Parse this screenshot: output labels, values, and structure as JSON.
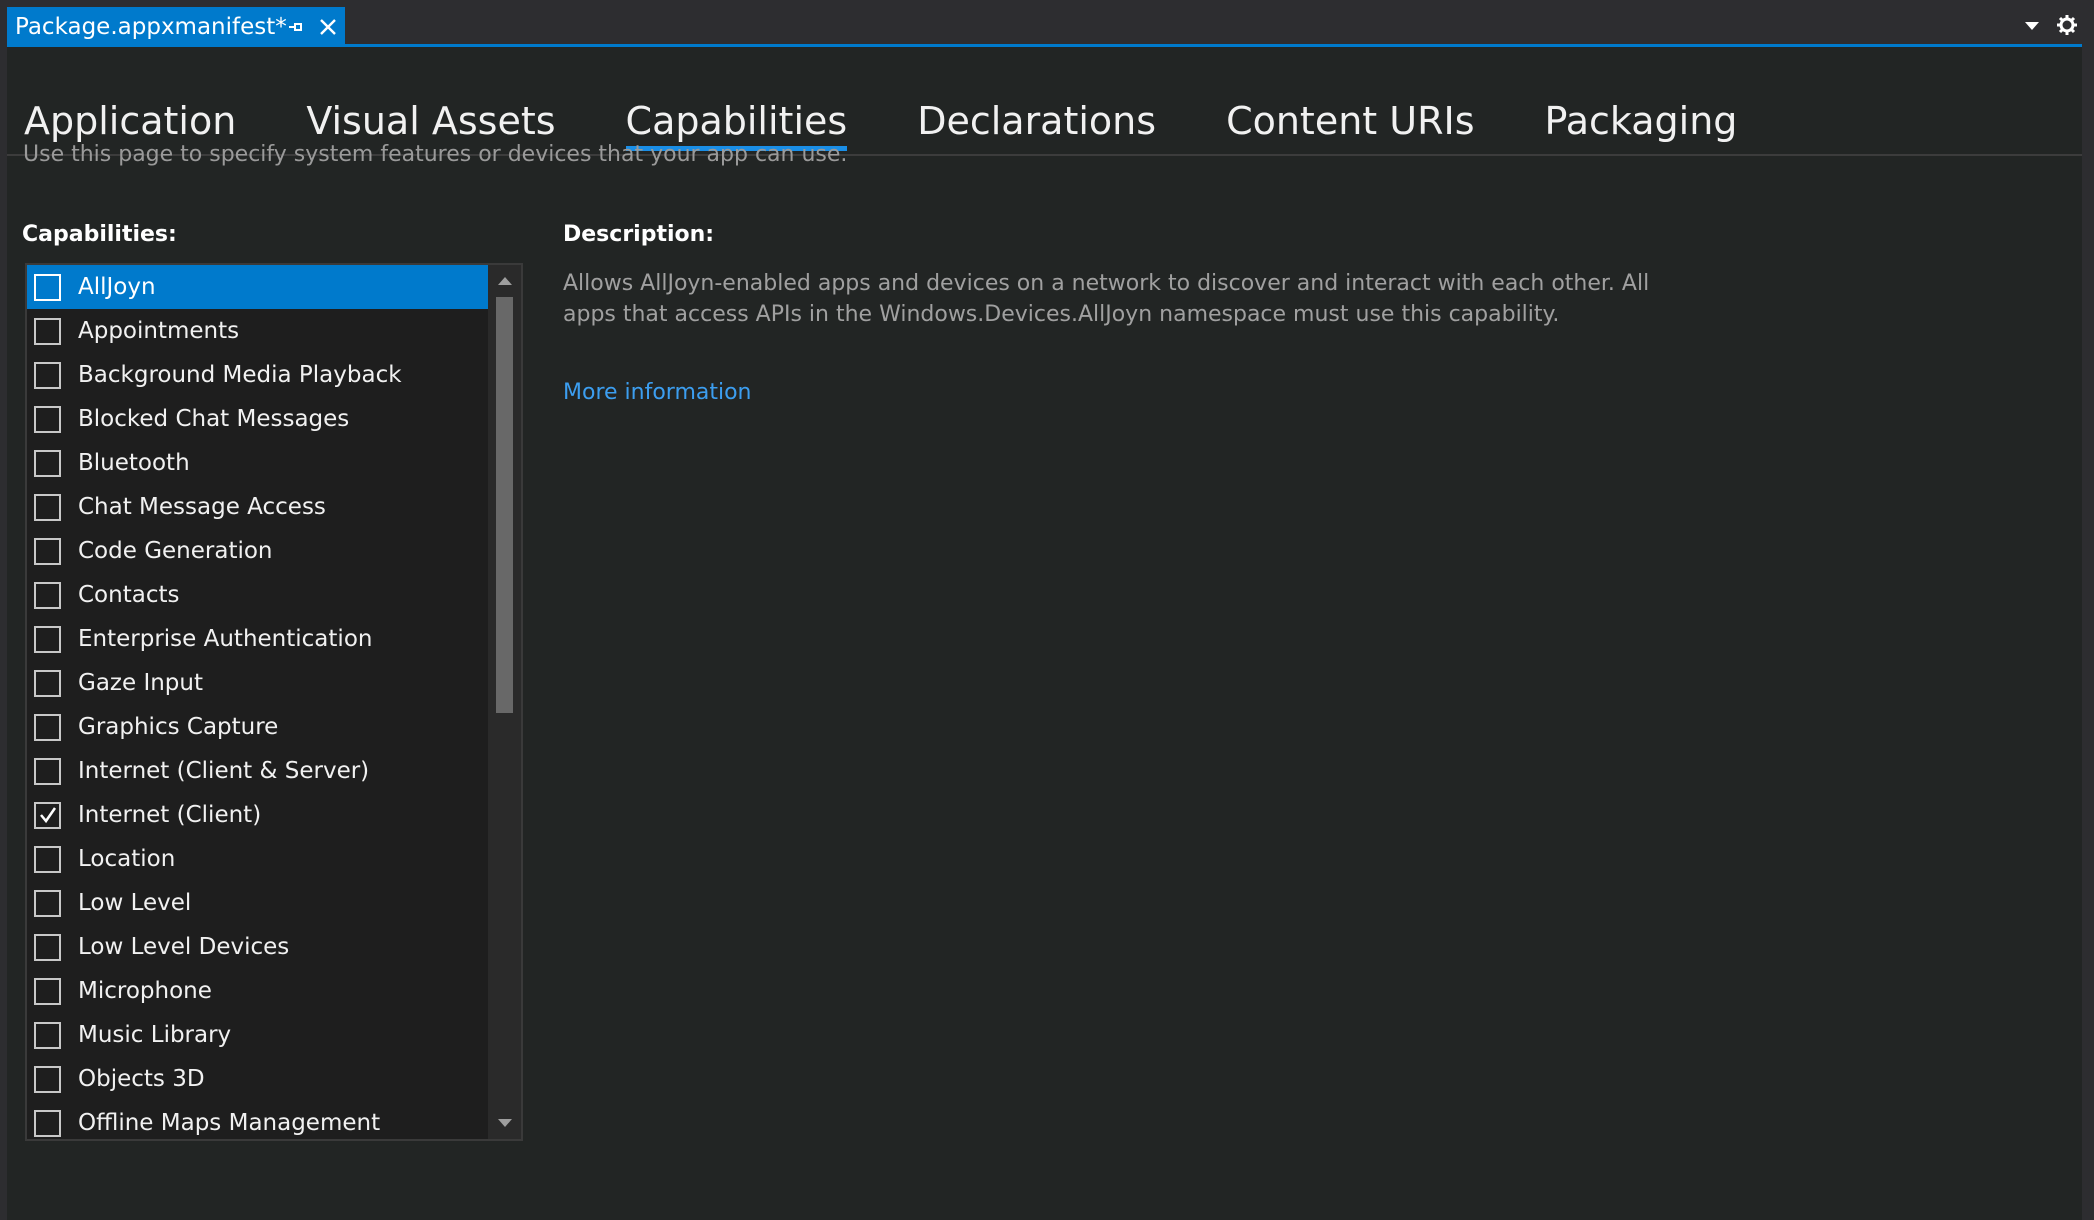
{
  "document_tab": {
    "title": "Package.appxmanifest*"
  },
  "nav_tabs": [
    {
      "label": "Application"
    },
    {
      "label": "Visual Assets"
    },
    {
      "label": "Capabilities",
      "active": true
    },
    {
      "label": "Declarations"
    },
    {
      "label": "Content URIs"
    },
    {
      "label": "Packaging"
    }
  ],
  "intro_text": "Use this page to specify system features or devices that your app can use.",
  "capabilities": {
    "label": "Capabilities:",
    "items": [
      {
        "label": "AllJoyn",
        "checked": false,
        "selected": true
      },
      {
        "label": "Appointments",
        "checked": false
      },
      {
        "label": "Background Media Playback",
        "checked": false
      },
      {
        "label": "Blocked Chat Messages",
        "checked": false
      },
      {
        "label": "Bluetooth",
        "checked": false
      },
      {
        "label": "Chat Message Access",
        "checked": false
      },
      {
        "label": "Code Generation",
        "checked": false
      },
      {
        "label": "Contacts",
        "checked": false
      },
      {
        "label": "Enterprise Authentication",
        "checked": false
      },
      {
        "label": "Gaze Input",
        "checked": false
      },
      {
        "label": "Graphics Capture",
        "checked": false
      },
      {
        "label": "Internet (Client & Server)",
        "checked": false
      },
      {
        "label": "Internet (Client)",
        "checked": true
      },
      {
        "label": "Location",
        "checked": false
      },
      {
        "label": "Low Level",
        "checked": false
      },
      {
        "label": "Low Level Devices",
        "checked": false
      },
      {
        "label": "Microphone",
        "checked": false
      },
      {
        "label": "Music Library",
        "checked": false
      },
      {
        "label": "Objects 3D",
        "checked": false
      },
      {
        "label": "Offline Maps Management",
        "checked": false
      }
    ]
  },
  "description": {
    "label": "Description:",
    "text": "Allows AllJoyn-enabled apps and devices on a network to discover and interact with each other. All apps that access APIs in the Windows.Devices.AllJoyn namespace must use this capability.",
    "link": "More information"
  },
  "colors": {
    "accent": "#007acc",
    "background": "#222524",
    "titlebar": "#2d2d30",
    "link": "#3c9ef0"
  },
  "icons": [
    "pin-icon",
    "close-icon",
    "chevron-down-icon",
    "gear-icon",
    "checkmark-icon",
    "scroll-up-arrow-icon",
    "scroll-down-arrow-icon"
  ]
}
